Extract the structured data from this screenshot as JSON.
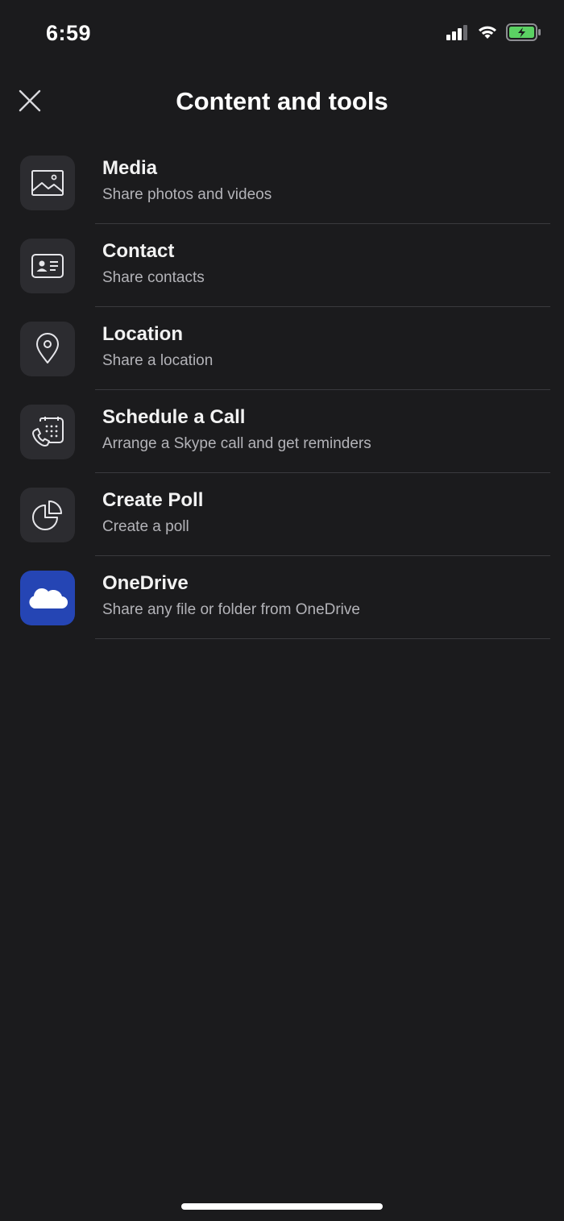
{
  "status": {
    "time": "6:59",
    "battery_color": "#5bd163"
  },
  "header": {
    "title": "Content and tools"
  },
  "items": [
    {
      "title": "Media",
      "subtitle": "Share photos and videos",
      "icon": "image-icon"
    },
    {
      "title": "Contact",
      "subtitle": "Share contacts",
      "icon": "contact-card-icon"
    },
    {
      "title": "Location",
      "subtitle": "Share a location",
      "icon": "location-pin-icon"
    },
    {
      "title": "Schedule a Call",
      "subtitle": "Arrange a Skype call and get reminders",
      "icon": "schedule-call-icon"
    },
    {
      "title": "Create Poll",
      "subtitle": "Create a poll",
      "icon": "pie-chart-icon"
    },
    {
      "title": "OneDrive",
      "subtitle": "Share any file or folder from OneDrive",
      "icon": "onedrive-cloud-icon"
    }
  ],
  "colors": {
    "background": "#1b1b1d",
    "icon_tile": "#2c2c30",
    "onedrive_tile": "#2545b4"
  }
}
